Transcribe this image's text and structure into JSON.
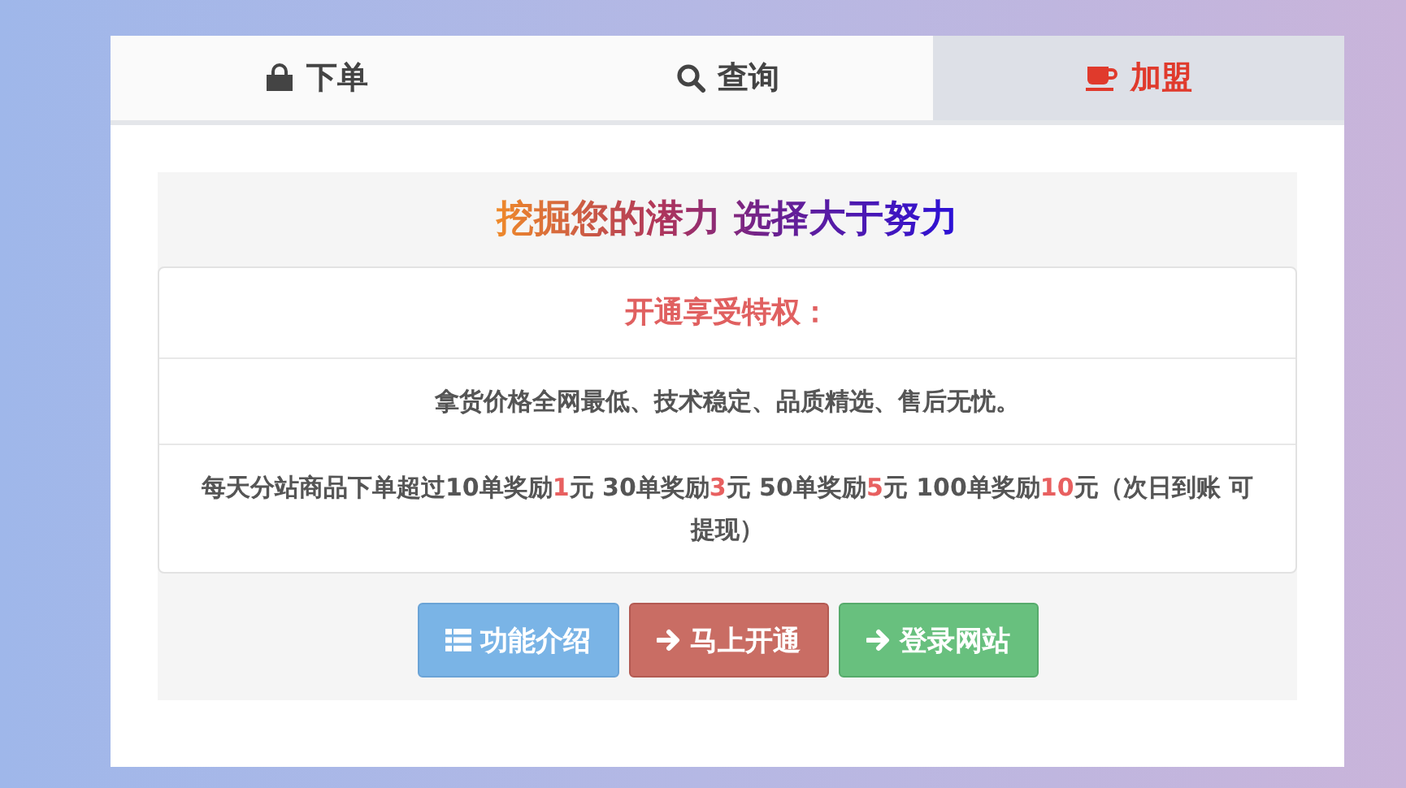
{
  "tabs": [
    {
      "label": "下单",
      "selected": false
    },
    {
      "label": "查询",
      "selected": false
    },
    {
      "label": "加盟",
      "selected": true
    }
  ],
  "headline": "挖掘您的潜力 选择大于努力",
  "privileges": {
    "title": "开通享受特权：",
    "lines": [
      [
        {
          "text": "拿货价格全网最低、技术稳定、品质精选、售后无忧。",
          "highlight": false
        }
      ],
      [
        {
          "text": "每天分站商品下单超过10单奖励",
          "highlight": false
        },
        {
          "text": "1",
          "highlight": true
        },
        {
          "text": "元 30单奖励",
          "highlight": false
        },
        {
          "text": "3",
          "highlight": true
        },
        {
          "text": "元 50单奖励",
          "highlight": false
        },
        {
          "text": "5",
          "highlight": true
        },
        {
          "text": "元 100单奖励",
          "highlight": false
        },
        {
          "text": "10",
          "highlight": true
        },
        {
          "text": "元（次日到账 可提现）",
          "highlight": false
        }
      ]
    ]
  },
  "buttons": [
    {
      "label": "功能介绍",
      "kind": "info"
    },
    {
      "label": "马上开通",
      "kind": "danger"
    },
    {
      "label": "登录网站",
      "kind": "success"
    }
  ]
}
